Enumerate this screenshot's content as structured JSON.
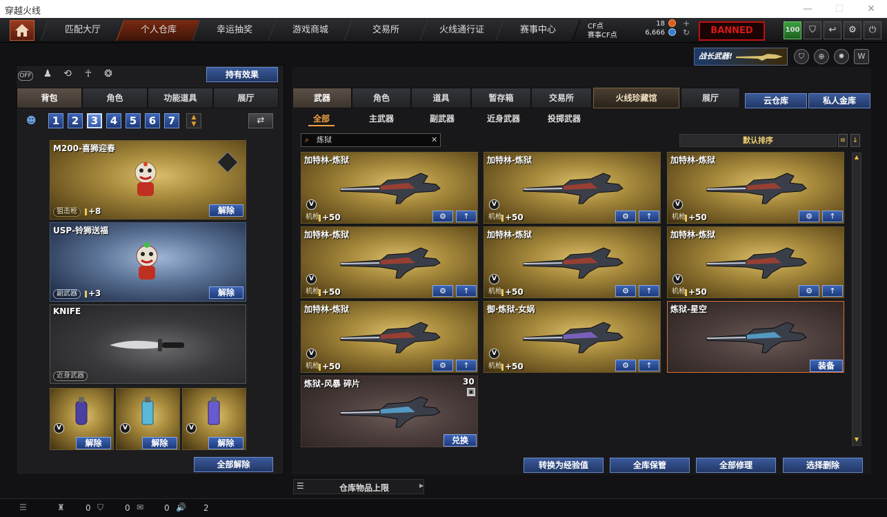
{
  "window": {
    "title": "穿越火线",
    "minimize": "—",
    "maximize": "☐",
    "close": "✕"
  },
  "topnav": {
    "tabs": [
      "匹配大厅",
      "个人仓库",
      "幸运抽奖",
      "游戏商城",
      "交易所",
      "火线通行证",
      "赛事中心"
    ],
    "active_tab": "个人仓库",
    "cf_label": "CF点",
    "cf_value": "18",
    "cfcf_label": "赛事CF点",
    "cfcf_value": "6,666",
    "red_badge": "BANNED",
    "level_badge": "100"
  },
  "promo": {
    "text": "战长武器!"
  },
  "left": {
    "effect_button": "持有效果",
    "tabs": [
      "背包",
      "角色",
      "功能道具",
      "展厅"
    ],
    "active_tab": "背包",
    "slots": [
      "1",
      "2",
      "3",
      "4",
      "5",
      "6",
      "7"
    ],
    "active_slot": "3",
    "cards": [
      {
        "title": "M200-喜狮迎春",
        "tag": "狙击枪",
        "bonus": "+8",
        "button": "解除"
      },
      {
        "title": "USP-铃狮送福",
        "tag": "副武器",
        "bonus": "+3",
        "button": "解除"
      },
      {
        "title": "KNIFE",
        "tag": "近身武器"
      }
    ],
    "grenades": [
      {
        "button": "解除"
      },
      {
        "button": "解除"
      },
      {
        "button": "解除"
      }
    ],
    "unequip_all": "全部解除"
  },
  "right": {
    "tabs": [
      "武器",
      "角色",
      "道具",
      "暂存箱",
      "交易所",
      "火线珍藏馆",
      "展厅"
    ],
    "active_tab": "武器",
    "cloud_tabs": [
      "云仓库",
      "私人金库"
    ],
    "subtabs": [
      "全部",
      "主武器",
      "副武器",
      "近身武器",
      "投掷武器"
    ],
    "active_subtab": "全部",
    "search_value": "炼狱",
    "sort_label": "默认排序",
    "items": [
      {
        "title": "加特林-炼狱",
        "tag": "机枪",
        "bonus": "+50"
      },
      {
        "title": "加特林-炼狱",
        "tag": "机枪",
        "bonus": "+50"
      },
      {
        "title": "加特林-炼狱",
        "tag": "机枪",
        "bonus": "+50"
      },
      {
        "title": "加特林-炼狱",
        "tag": "机枪",
        "bonus": "+50"
      },
      {
        "title": "加特林-炼狱",
        "tag": "机枪",
        "bonus": "+50"
      },
      {
        "title": "加特林-炼狱",
        "tag": "机枪",
        "bonus": "+50"
      },
      {
        "title": "加特林-炼狱",
        "tag": "机枪",
        "bonus": "+50"
      },
      {
        "title": "御·炼狱-女娲",
        "tag": "机枪",
        "bonus": "+50"
      },
      {
        "title": "炼狱-星空",
        "button": "装备"
      },
      {
        "title": "炼狱-风暴 碎片",
        "count": "30",
        "button": "兑换"
      }
    ],
    "bottom_buttons": [
      "转换为经验值",
      "全库保管",
      "全部修理",
      "选择删除"
    ],
    "capacity_label": "仓库物品上限"
  },
  "statusbar": {
    "v1": "0",
    "v2": "0",
    "v3": "0",
    "v4": "2"
  }
}
